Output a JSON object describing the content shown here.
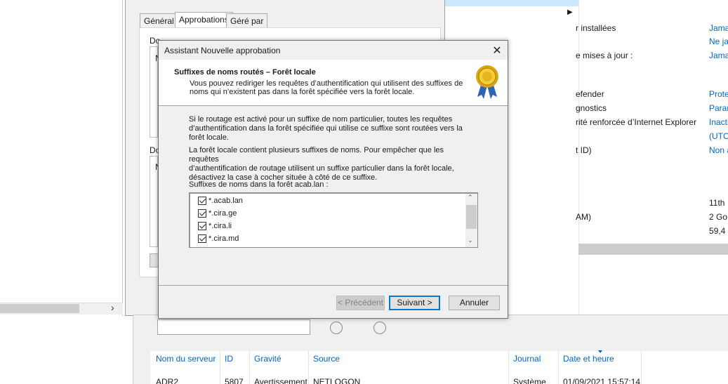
{
  "background": {
    "props_tabs": [
      "Général",
      "Approbations",
      "Géré par"
    ],
    "props_text1": "Do",
    "props_text2": "Do",
    "props_letter1": "N",
    "props_letter2": "N",
    "right_labels": [
      "r installées",
      "e mises à jour :",
      "efender",
      "gnostics",
      "rité renforcée d’Internet Explorer",
      "t ID)",
      "AM)"
    ],
    "right_values": [
      "Jama",
      "Ne ja",
      "Jama",
      "Prote",
      "Param",
      "Inacti",
      "(UTC-",
      "Non a",
      "11th",
      "2 Go",
      "59,4"
    ],
    "columns": [
      "Nom du serveur",
      "ID",
      "Gravité",
      "Source",
      "Journal",
      "Date et heure"
    ],
    "row": [
      "ADR2",
      "5807",
      "Avertissement",
      "NETLOGON",
      "Système",
      "01/09/2021 15:57:14"
    ]
  },
  "dialog": {
    "title": "Assistant Nouvelle approbation",
    "heading": "Suffixes de noms routés – Forêt locale",
    "subheading_line1": "Vous pouvez rediriger les requêtes d’authentification qui utilisent des suffixes de",
    "subheading_line2": "noms qui n’existent pas dans la forêt spécifiée vers la forêt locale.",
    "para1_line1": "Si le routage est activé pour un suffixe de nom particulier, toutes les requêtes",
    "para1_line2": "d’authentification dans la forêt spécifiée qui utilise ce suffixe sont routées vers la",
    "para1_line3": "forêt locale.",
    "para2_line1": "La forêt locale contient plusieurs suffixes de noms. Pour empêcher que les requêtes",
    "para2_line2": "d’authentification de routage utilisent un suffixe particulier dans la forêt locale,",
    "para2_line3": "désactivez la case à cocher située à côté de ce suffixe.",
    "list_label": "Suffixes de noms dans la forêt acab.lan :",
    "suffixes": [
      {
        "name": "*.acab.lan",
        "checked": true
      },
      {
        "name": "*.cira.ge",
        "checked": true
      },
      {
        "name": "*.cira.li",
        "checked": true
      },
      {
        "name": "*.cira.md",
        "checked": true
      }
    ],
    "btn_prev": "< Précédent",
    "btn_next": "Suivant >",
    "btn_cancel": "Annuler"
  }
}
